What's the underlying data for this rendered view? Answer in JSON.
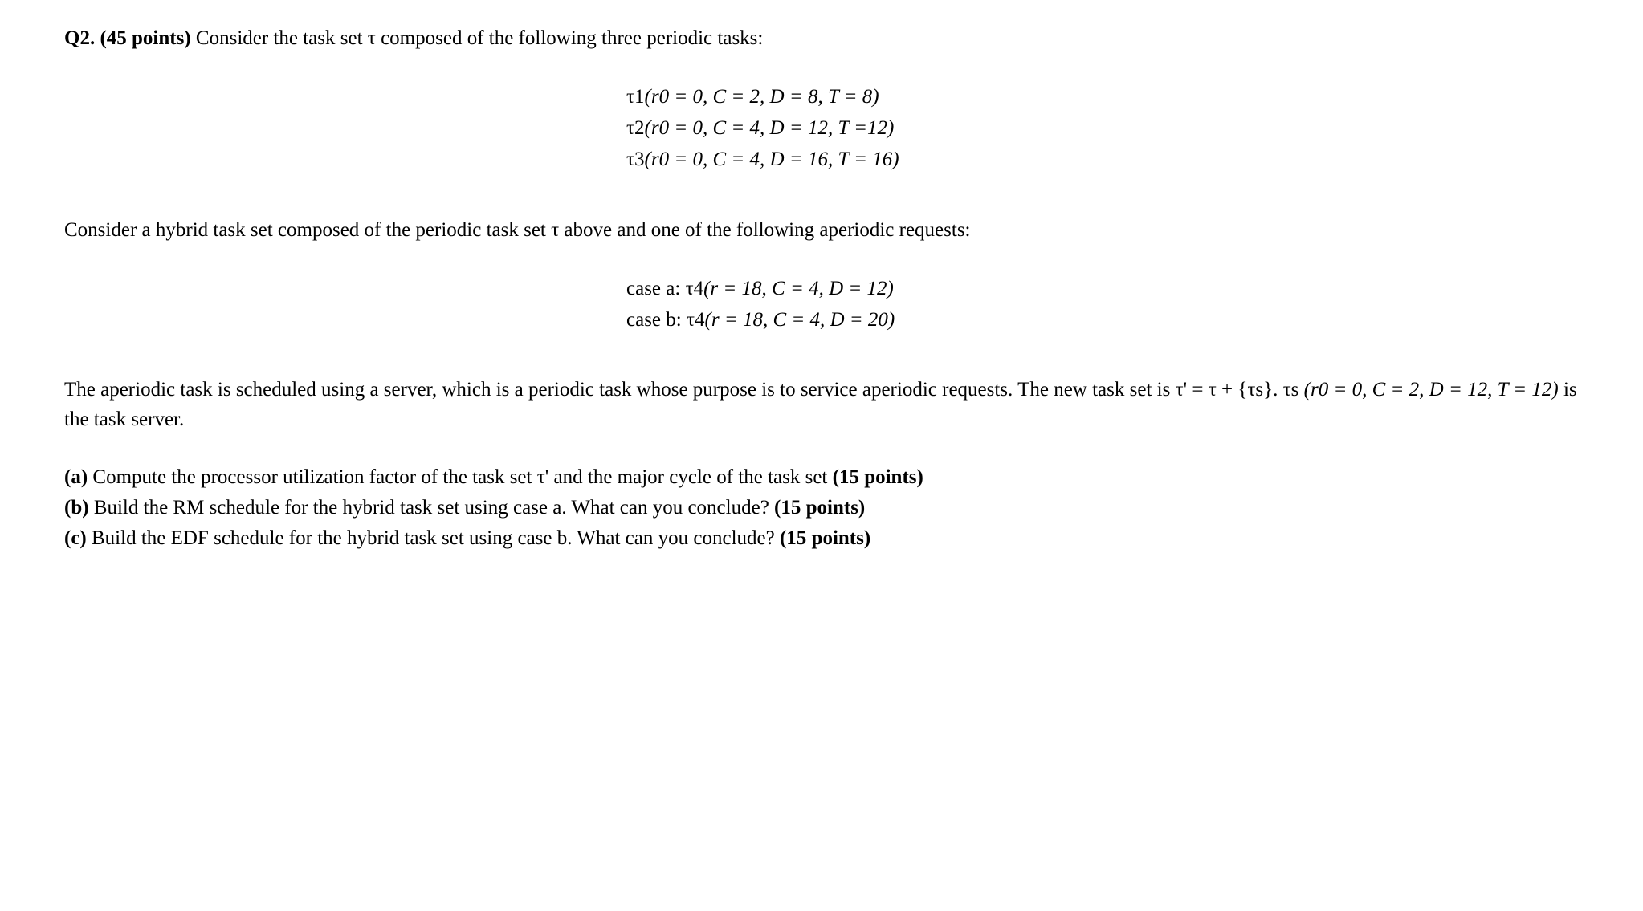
{
  "question": {
    "label": "Q2.",
    "points": "(45 points)",
    "intro": "Consider the task set τ composed of the following three periodic tasks:"
  },
  "tasks": {
    "t1": {
      "name": "τ1",
      "params": "(r0 = 0, C = 2, D = 8,  T = 8)"
    },
    "t2": {
      "name": "τ2",
      "params": "(r0 = 0, C = 4, D = 12,  T =12)"
    },
    "t3": {
      "name": "τ3",
      "params": "(r0 = 0, C = 4, D = 16,  T = 16)"
    }
  },
  "hybrid_intro": "Consider a hybrid task set composed of the periodic task set τ above and one of the following aperiodic requests:",
  "cases": {
    "a": {
      "label": "case a: ",
      "name": "τ4",
      "params": "(r = 18, C = 4, D = 12)"
    },
    "b": {
      "label": "case b: ",
      "name": "τ4",
      "params": "(r = 18, C = 4, D = 20)"
    }
  },
  "server_para": {
    "p1a": "The aperiodic task is scheduled using a server, which is a periodic task whose purpose is to service aperiodic requests. The new task set is τ' = τ + {τs}. τs ",
    "p1b": "(r0 = 0, C = 2, D = 12,  T = 12)",
    "p1c": " is the task server."
  },
  "subparts": {
    "a": {
      "label": "(a)",
      "text": " Compute the processor utilization factor of the task set τ' and the major cycle of the task set ",
      "pts": "(15 points)"
    },
    "b": {
      "label": "(b)",
      "text": " Build the RM schedule for the hybrid task set using case a. What can you conclude? ",
      "pts": "(15 points)"
    },
    "c": {
      "label": "(c)",
      "text": " Build the EDF schedule for the hybrid task set using case b. What can you conclude? ",
      "pts": "(15 points)"
    }
  }
}
